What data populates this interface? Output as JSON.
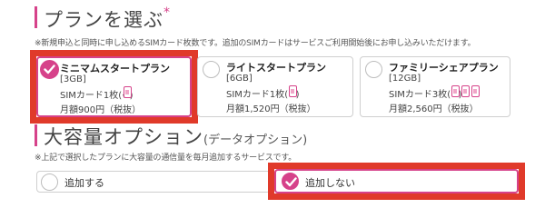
{
  "plan_section": {
    "title": "プランを選ぶ",
    "required_mark": "*",
    "note": "※新規申込と同時に申し込めるSIMカード枚数です。追加のSIMカードはサービスご利用開始後にお申し込みいただけます。"
  },
  "plans": [
    {
      "name": "ミニマムスタートプラン",
      "capacity": "[3GB]",
      "sim": "SIMカード1枚(※)",
      "sim_count": 1,
      "price": "月額900円（税抜）",
      "selected": true
    },
    {
      "name": "ライトスタートプラン",
      "capacity": "[6GB]",
      "sim": "SIMカード1枚(※)",
      "sim_count": 1,
      "price": "月額1,520円（税抜）",
      "selected": false
    },
    {
      "name": "ファミリーシェアプラン",
      "capacity": "[12GB]",
      "sim": "SIMカード3枚(※)",
      "sim_count": 3,
      "price": "月額2,560円（税抜）",
      "selected": false
    }
  ],
  "option_section": {
    "title": "大容量オプション",
    "subtitle": "(データオプション)",
    "note": "※上記で選択したプランに大容量の通信量を毎月追加するサービスです。"
  },
  "options": [
    {
      "label": "追加する",
      "selected": false
    },
    {
      "label": "追加しない",
      "selected": true
    }
  ],
  "colors": {
    "accent": "#d6428a",
    "highlight_frame": "#e03a2a",
    "border": "#cfcfcf"
  },
  "icons": {
    "check": "check-icon",
    "sim": "sim-card-icon"
  }
}
